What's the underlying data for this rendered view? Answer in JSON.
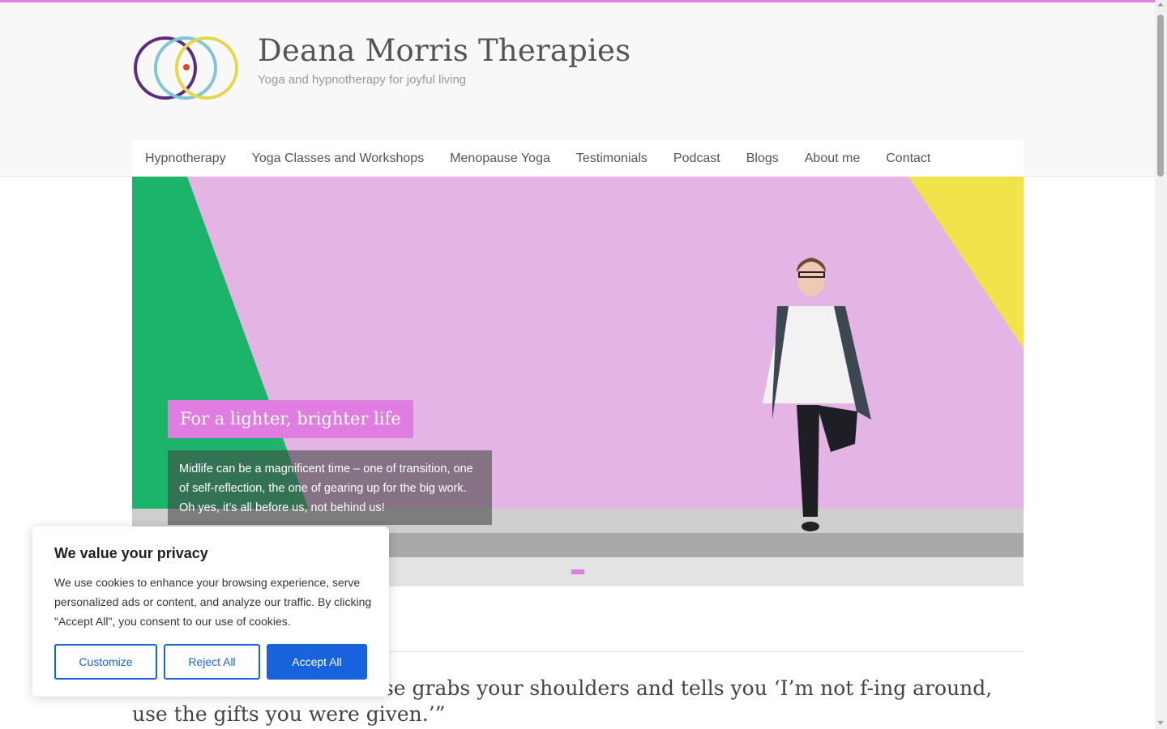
{
  "site": {
    "title": "Deana Morris Therapies",
    "tagline": "Yoga and hypnotherapy for joyful living",
    "accent_color": "#e07de0"
  },
  "nav": {
    "items": [
      {
        "label": "Hypnotherapy"
      },
      {
        "label": "Yoga Classes and Workshops"
      },
      {
        "label": "Menopause Yoga"
      },
      {
        "label": "Testimonials"
      },
      {
        "label": "Podcast"
      },
      {
        "label": "Blogs"
      },
      {
        "label": "About me"
      },
      {
        "label": "Contact"
      }
    ]
  },
  "hero": {
    "title": "For a lighter, brighter life",
    "description": "Midlife can be a magnificent time – one of transition, one of self-reflection, the one of gearing up for the big work. Oh yes, it’s all before us, not behind us!",
    "slide_count": 1,
    "active_slide": 1
  },
  "quote": {
    "text": "“Aham: when the Universe grabs your shoulders and tells you ‘I’m not f-ing around, use the gifts you were given.’”"
  },
  "cookie_banner": {
    "title": "We value your privacy",
    "text": "We use cookies to enhance your browsing experience, serve personalized ads or content, and analyze our traffic. By clicking \"Accept All\", you consent to our use of cookies.",
    "customize_label": "Customize",
    "reject_label": "Reject All",
    "accept_label": "Accept All",
    "button_color": "#1863dc"
  },
  "icons": {
    "logo": "three-interlocking-circles-logo",
    "scroll_up": "scroll-up-arrow-icon",
    "scroll_down": "scroll-down-arrow-icon"
  }
}
